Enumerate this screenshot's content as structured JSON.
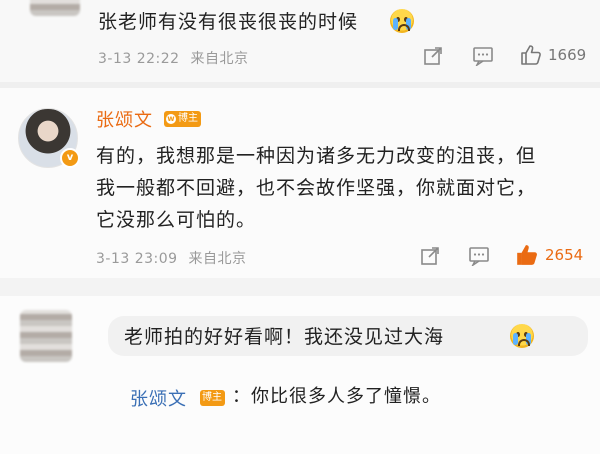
{
  "comments": [
    {
      "text": "张老师有没有很丧很丧的时候",
      "time": "3-13 22:22",
      "source": "来自北京",
      "likes": "1669"
    },
    {
      "author": "张颂文",
      "badge": "博主",
      "lines": [
        "有的，我想那是一种因为诸多无力改变的沮丧，但",
        "我一般都不回避，也不会故作坚强，你就面对它，",
        "它没那么可怕的。"
      ],
      "time": "3-13 23:09",
      "source": "来自北京",
      "likes": "2654",
      "liked": true
    },
    {
      "text": "老师拍的好好看啊！我还没见过大海",
      "reply_author": "张颂文",
      "reply_badge": "博主",
      "reply_text": "：你比很多人多了憧憬。"
    }
  ],
  "icons": {
    "share": "share-icon",
    "comment": "comment-icon",
    "like": "thumbs-up-icon",
    "emoji_cry": "crying-face-emoji",
    "verified": "verified-badge-icon"
  },
  "colors": {
    "accent_orange": "#ea6b13",
    "link_blue": "#3a6fb5",
    "badge_orange": "#f39a14",
    "meta_gray": "#9a9a9a"
  }
}
